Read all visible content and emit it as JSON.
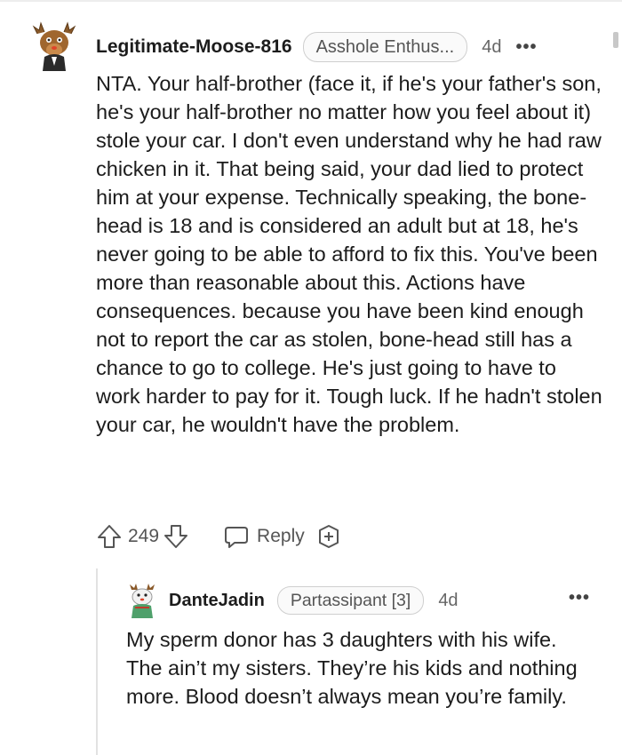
{
  "comment": {
    "author": "Legitimate-Moose-816",
    "flair": "Asshole Enthus...",
    "age": "4d",
    "more_icon": "more-horizontal-icon",
    "body": "NTA. Your half-brother (face it, if he's your father's son, he's your half-brother no matter how you feel about it) stole your car. I don't even understand why he had raw chicken in it. That being said, your dad lied to protect him at your expense. Technically speaking, the bone-head is 18 and is considered an adult but at 18, he's never going to be able to afford to fix this. You've been more than reasonable about this. Actions have consequences. because you have been kind enough not to report the car as stolen, bone-head still has a chance to go to college. He's just going to have to work harder to pay for it. Tough luck. If he hadn't stolen your car, he wouldn't have the problem.",
    "score": "249",
    "reply_label": "Reply",
    "icons": {
      "upvote": "upvote-arrow-icon",
      "downvote": "downvote-arrow-icon",
      "reply": "reply-bubble-icon",
      "award": "award-plus-icon"
    }
  },
  "reply": {
    "author": "DanteJadin",
    "flair": "Partassipant [3]",
    "age": "4d",
    "more_icon": "more-horizontal-icon",
    "body": "My sperm donor has 3 daughters with his wife. The ain’t my sisters. They’re his kids and nothing more. Blood doesn’t always mean you’re family."
  },
  "colors": {
    "text": "#1c1c1c",
    "meta": "#555555",
    "flair_border": "#cfcfcf",
    "thread_line": "#e2e2e2"
  }
}
